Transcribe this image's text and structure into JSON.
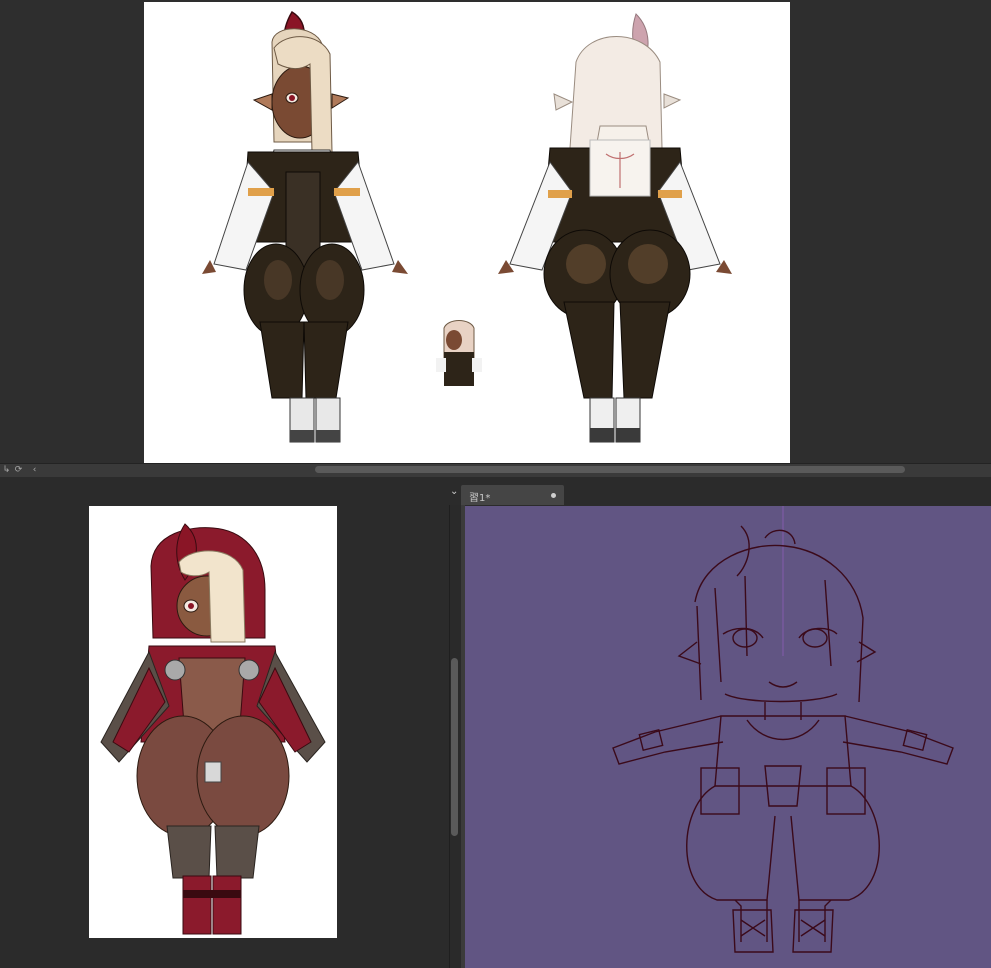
{
  "app": {
    "document_tab": {
      "label": "習1*"
    },
    "icons": {
      "hbar_left_1": "arrow-icon",
      "hbar_left_2": "rotate-icon",
      "hbar_left_3": "chevron-left-icon",
      "splitter": "chevron-down-icon",
      "tab_close": "dot-icon"
    }
  },
  "colors": {
    "workspace": "#2e2e2e",
    "canvas_white": "#ffffff",
    "sketch_bg": "#615583",
    "lineart": "#3b0a1a",
    "skin_dark": "#7a4a33",
    "hair_blonde": "#e8d8c0",
    "horn_red": "#8a1526",
    "suit_black": "#2d2418",
    "coat_red": "#8b1a2c"
  }
}
